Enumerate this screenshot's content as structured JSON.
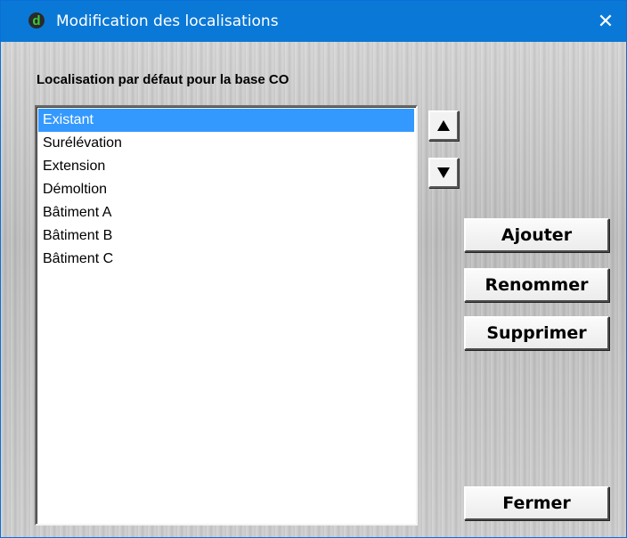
{
  "window": {
    "title": "Modification des localisations",
    "close_glyph": "✕",
    "title_bar_color": "#0a78d7"
  },
  "section": {
    "label": "Localisation par défaut pour la base CO"
  },
  "locations": {
    "selected_index": 0,
    "items": [
      "Existant",
      "Surélévation",
      "Extension",
      "Démoltion",
      "Bâtiment A",
      "Bâtiment B",
      "Bâtiment C"
    ]
  },
  "actions": {
    "move_up_icon": "triangle-up",
    "move_down_icon": "triangle-down",
    "add_label": "Ajouter",
    "rename_label": "Renommer",
    "delete_label": "Supprimer",
    "close_label": "Fermer"
  },
  "colors": {
    "selection": "#3399ff",
    "app_icon_bg": "#2a2a2a",
    "app_icon_fg": "#3ac93a"
  }
}
